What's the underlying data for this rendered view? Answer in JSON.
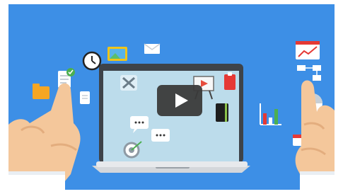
{
  "scene": {
    "background_color": "#3d8fe6",
    "laptop_screen_color": "#bcdceb",
    "play_button_color": "#3a3a3a",
    "hand_color": "#f4c79b",
    "cuff_color": "#ffffff"
  },
  "player": {
    "play_icon": "play-icon"
  },
  "icons": [
    "folder-icon",
    "document-check-icon",
    "clock-icon",
    "photo-icon",
    "envelope-icon",
    "page-icon",
    "tools-icon",
    "presentation-board-icon",
    "binder-icon",
    "notebook-icon",
    "chat-bubble-icon",
    "target-icon",
    "bar-chart-icon",
    "line-chart-icon",
    "org-chart-icon",
    "pie-chart-icon"
  ]
}
